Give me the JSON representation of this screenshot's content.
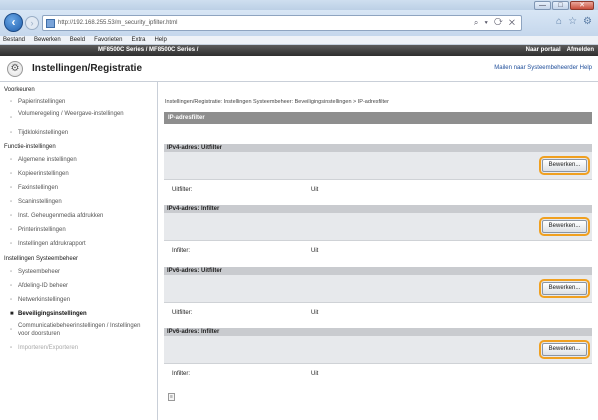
{
  "window": {
    "minimize": "—",
    "maximize": "□",
    "close": "✕"
  },
  "browser": {
    "url": "http://192.168.255.53/m_security_ipfilter.html",
    "tools": "⌕ ▾ ⟳ ✕",
    "tab_icons": [
      "⌂",
      "☆",
      "⚙"
    ]
  },
  "menubar": {
    "items": [
      "Bestand",
      "Bewerken",
      "Beeld",
      "Favorieten",
      "Extra",
      "Help"
    ]
  },
  "site_header": {
    "model_text": "MF8500C Series / MF8500C Series /",
    "links": [
      "Naar portaal",
      "Afmelden"
    ],
    "page_title": "Instellingen/Registratie",
    "admin_link": "Mailen naar Systeembeheerder  Help"
  },
  "sidebar": {
    "groups": [
      {
        "title": "Voorkeuren",
        "items": [
          {
            "label": "Papierinstellingen"
          },
          {
            "label": "Volumeregeling / Weergave-instellingen"
          },
          {
            "label": "Tijdklokinstellingen"
          }
        ]
      },
      {
        "title": "Functie-instellingen",
        "items": [
          {
            "label": "Algemene instellingen"
          },
          {
            "label": "Kopieerinstellingen"
          },
          {
            "label": "Faxinstellingen"
          },
          {
            "label": "Scaninstellingen"
          },
          {
            "label": "Inst. Geheugenmedia afdrukken"
          },
          {
            "label": "Printerinstellingen"
          },
          {
            "label": "Instellingen afdrukrapport"
          }
        ]
      },
      {
        "title": "Instellingen Systeembeheer",
        "items": [
          {
            "label": "Systeembeheer"
          },
          {
            "label": "Afdeling-ID beheer"
          },
          {
            "label": "Netwerkinstellingen"
          },
          {
            "label": "Beveiligingsinstellingen"
          },
          {
            "label": "Communicatiebeheerinstellingen / Instellingen voor doorsturen"
          },
          {
            "label": "Importeren/Exporteren"
          }
        ]
      }
    ]
  },
  "main": {
    "breadcrumb": "Instellingen/Registratie: Instellingen Systeembeheer: Beveiligingsinstellingen > IP-adresfilter",
    "title": "IP-adresfilter",
    "edit_label": "Bewerken...",
    "sections": [
      {
        "header": "IPv4-adres: Uitfilter",
        "row_label": "Uitfilter:",
        "row_value": "Uit"
      },
      {
        "header": "IPv4-adres: Infilter",
        "row_label": "Infilter:",
        "row_value": "Uit"
      },
      {
        "header": "IPv6-adres: Uitfilter",
        "row_label": "Uitfilter:",
        "row_value": "Uit"
      },
      {
        "header": "IPv6-adres: Infilter",
        "row_label": "Infilter:",
        "row_value": "Uit"
      }
    ]
  }
}
